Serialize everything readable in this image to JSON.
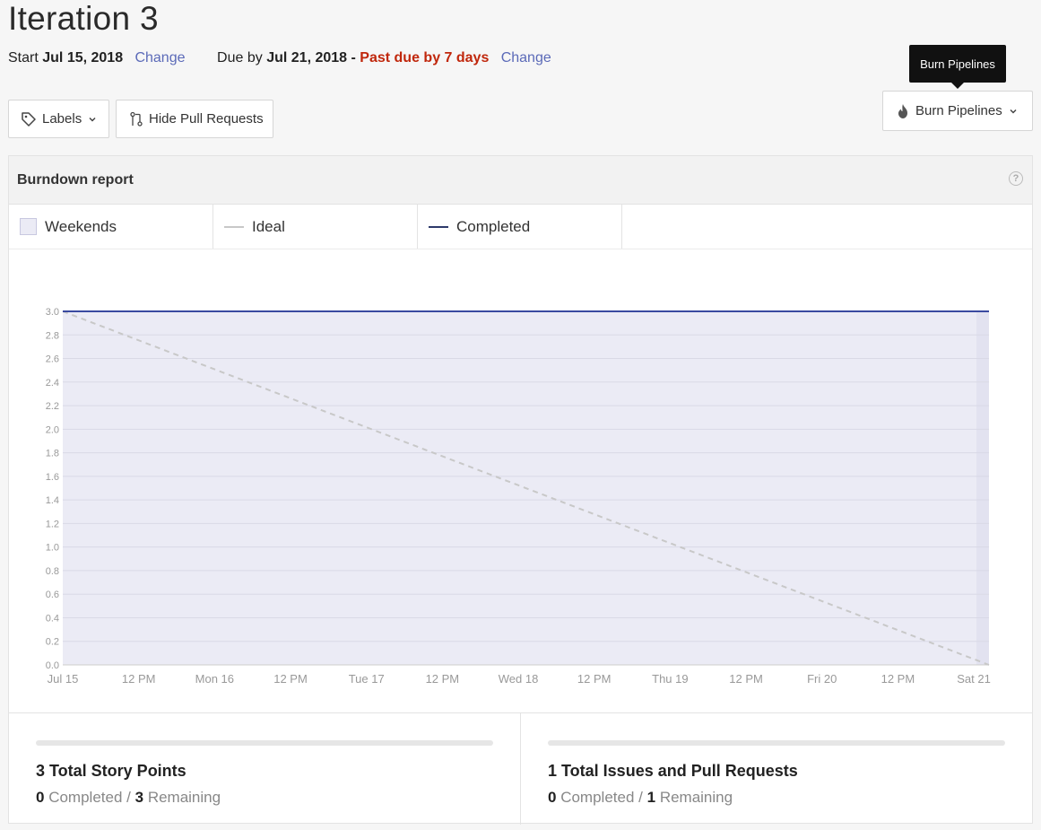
{
  "header": {
    "title": "Iteration 3",
    "start_label": "Start",
    "start_date": "Jul 15, 2018",
    "change_label": "Change",
    "due_label": "Due by",
    "due_date": "Jul 21, 2018",
    "separator": "-",
    "past_due": "Past due by 7 days",
    "change_label_2": "Change"
  },
  "toolbar": {
    "labels_button": "Labels",
    "hide_prs_button": "Hide Pull Requests",
    "burn_button": "Burn Pipelines",
    "tooltip": "Burn Pipelines"
  },
  "report": {
    "title": "Burndown report",
    "help_icon": "?",
    "legend": {
      "weekends": "Weekends",
      "ideal": "Ideal",
      "completed": "Completed"
    }
  },
  "chart_data": {
    "type": "line",
    "x_labels": [
      "Jul 15",
      "12 PM",
      "Mon 16",
      "12 PM",
      "Tue 17",
      "12 PM",
      "Wed 18",
      "12 PM",
      "Thu 19",
      "12 PM",
      "Fri 20",
      "12 PM",
      "Sat 21"
    ],
    "y_ticks": [
      "0.0",
      "0.2",
      "0.4",
      "0.6",
      "0.8",
      "1.0",
      "1.2",
      "1.4",
      "1.6",
      "1.8",
      "2.0",
      "2.2",
      "2.4",
      "2.6",
      "2.8",
      "3.0"
    ],
    "ylim": [
      0,
      3.0
    ],
    "xlim_days": [
      0,
      6.1
    ],
    "series": [
      {
        "name": "Ideal",
        "style": "dashed",
        "color": "#c8c8c8",
        "points": [
          [
            0,
            3.0
          ],
          [
            6.1,
            0.0
          ]
        ]
      },
      {
        "name": "Completed",
        "style": "solid",
        "color": "#3a4aa0",
        "points": [
          [
            0,
            3.0
          ],
          [
            6.1,
            3.0
          ]
        ]
      }
    ],
    "weekend_color": "#ebebf5",
    "grid": true
  },
  "stats": {
    "points": {
      "title": "3 Total Story Points",
      "completed_num": "0",
      "completed_label": "Completed /",
      "remaining_num": "3",
      "remaining_label": "Remaining",
      "progress_fraction": 0
    },
    "issues": {
      "title": "1 Total Issues and Pull Requests",
      "completed_num": "0",
      "completed_label": "Completed /",
      "remaining_num": "1",
      "remaining_label": "Remaining",
      "progress_fraction": 0
    }
  }
}
